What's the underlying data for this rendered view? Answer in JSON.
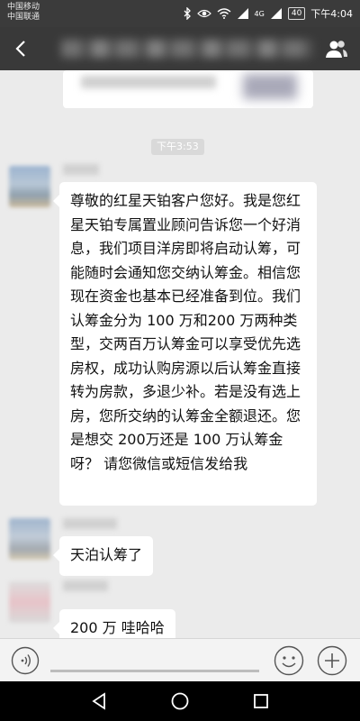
{
  "status_bar": {
    "carrier_1": "中国移动",
    "carrier_2": "中国联通",
    "network": "4G",
    "battery": "40",
    "time": "下午4:04"
  },
  "nav": {
    "title": "",
    "back_icon": "back-arrow-icon",
    "contact_icon": "group-contacts-icon"
  },
  "chat": {
    "time_divider": "下午3:53",
    "messages": [
      {
        "sender": "",
        "text": "尊敬的红星天铂客户您好。我是您红星天铂专属置业顾问告诉您一个好消息，我们项目洋房即将启动认筹，可能随时会通知您交纳认筹金。相信您现在资金也基本已经准备到位。我们认筹金分为 100 万和200 万两种类型，交两百万认筹金可以享受优先选房权，成功认购房源以后认筹金直接转为房款，多退少补。若是没有选上房，您所交纳的认筹金全额退还。您是想交 200万还是 100 万认筹金呀？ 请您微信或短信发给我"
      },
      {
        "sender": "",
        "text": "天泊认筹了"
      },
      {
        "sender": "",
        "text": "200 万 哇哈哈"
      }
    ]
  },
  "input_bar": {
    "placeholder": "",
    "voice_icon": "voice-icon",
    "emoji_icon": "emoji-icon",
    "add_icon": "plus-icon"
  },
  "system_nav": {
    "back_icon": "triangle-back-icon",
    "home_icon": "circle-home-icon",
    "recents_icon": "square-recents-icon"
  },
  "colors": {
    "status_bar": "#3b3b3b",
    "nav_bar": "#393939",
    "chat_background": "#ebebeb",
    "bubble": "#ffffff",
    "time_badge": "#d9d9d9"
  }
}
